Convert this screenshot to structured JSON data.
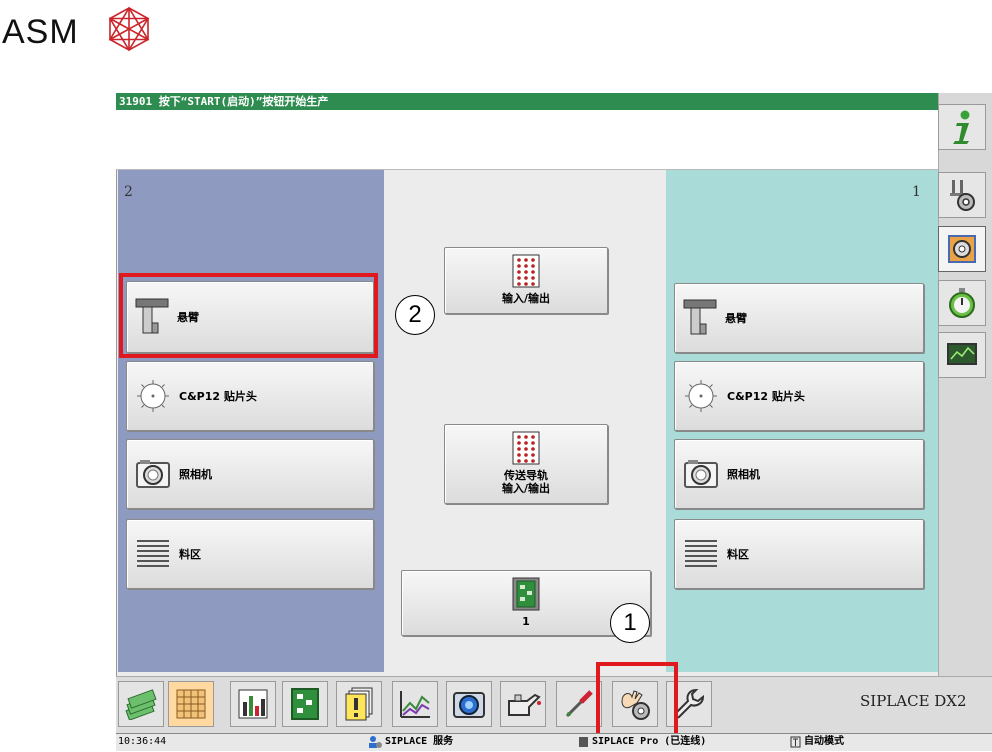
{
  "logo": {
    "text": "ASM"
  },
  "message": {
    "text": "31901 按下“START(启动)”按钮开始生产"
  },
  "gantry_left": {
    "number": "2",
    "buttons": [
      {
        "label": "悬臂",
        "icon": "cantilever-icon"
      },
      {
        "label": "C&P12 贴片头",
        "icon": "placement-head-icon"
      },
      {
        "label": "照相机",
        "icon": "camera-icon"
      },
      {
        "label": "料区",
        "icon": "feeder-area-icon"
      }
    ]
  },
  "gantry_right": {
    "number": "1",
    "buttons": [
      {
        "label": "悬臂",
        "icon": "cantilever-icon"
      },
      {
        "label": "C&P12 贴片头",
        "icon": "placement-head-icon"
      },
      {
        "label": "照相机",
        "icon": "camera-icon"
      },
      {
        "label": "料区",
        "icon": "feeder-area-icon"
      }
    ]
  },
  "center": {
    "io_label": "输入/输出",
    "conveyor_label_1": "传送导轨",
    "conveyor_label_2": "输入/输出",
    "board_label": "1"
  },
  "callouts": {
    "one": "1",
    "two": "2"
  },
  "toolbar": {
    "machine_name": "SIPLACE DX2",
    "icons": [
      "money-icon",
      "grid-icon",
      "bar-chart-icon",
      "board-icon",
      "alert-list-icon",
      "line-chart-icon",
      "camera-icon",
      "oil-can-icon",
      "pipette-icon",
      "hand-gear-icon",
      "wrench-icon"
    ]
  },
  "status": {
    "time": "10:36:44",
    "service": "SIPLACE 服务",
    "connection": "SIPLACE Pro (已连线)",
    "mode": "自动模式"
  },
  "colors": {
    "message_bar": "#2f8c50",
    "gantry_left": "#8f9ac0",
    "gantry_right": "#a9dbd8",
    "highlight": "#e0191f"
  }
}
